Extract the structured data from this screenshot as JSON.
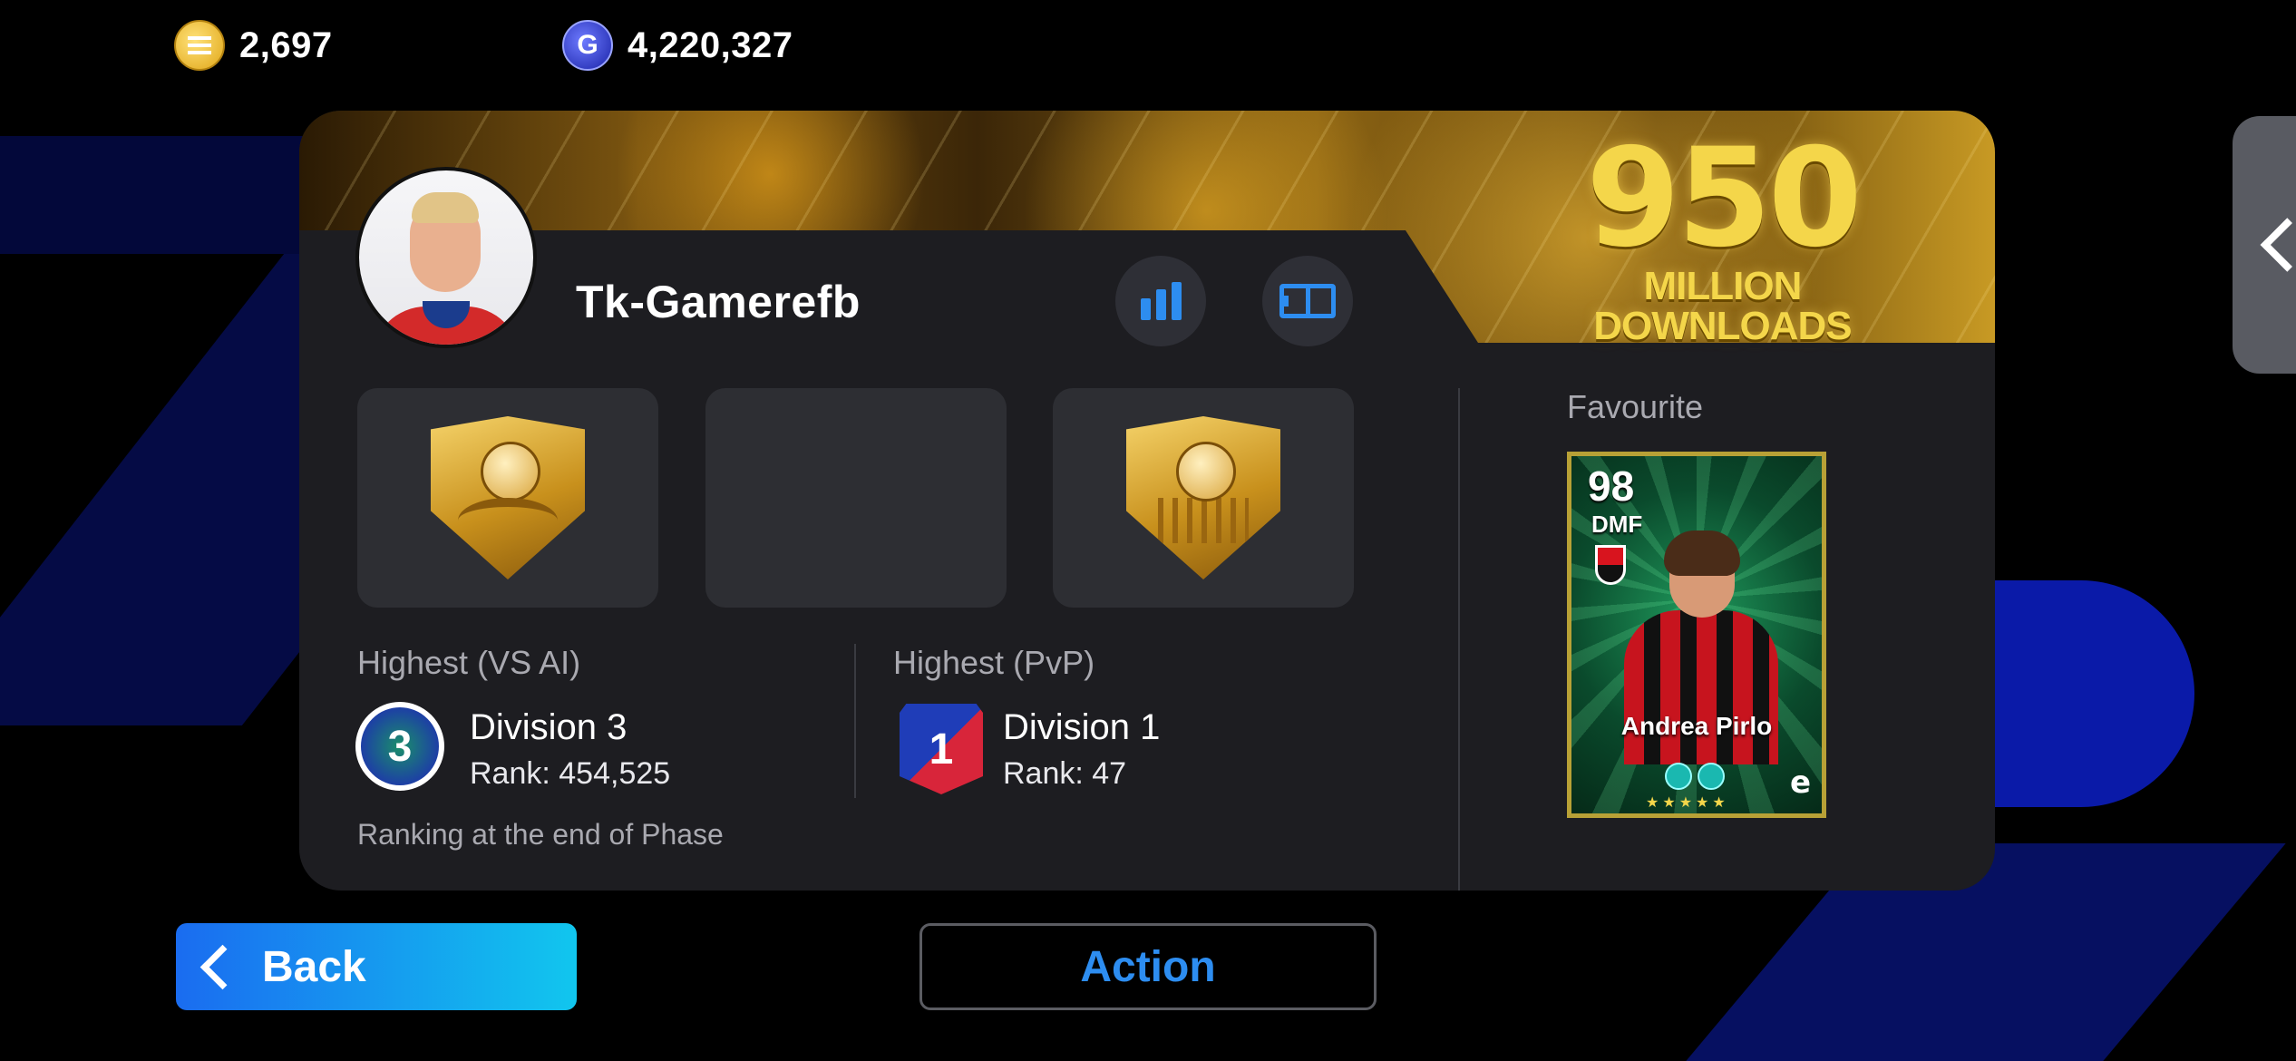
{
  "currency": {
    "coins": "2,697",
    "gp": "4,220,327"
  },
  "banner": {
    "number": "950",
    "line1": "MILLION",
    "line2": "DOWNLOADS"
  },
  "profile": {
    "username": "Tk-Gamerefb"
  },
  "stats": {
    "ai": {
      "label": "Highest (VS AI)",
      "badge": "3",
      "division": "Division 3",
      "rank": "Rank: 454,525"
    },
    "pvp": {
      "label": "Highest (PvP)",
      "badge": "1",
      "division": "Division 1",
      "rank": "Rank: 47"
    },
    "note": "Ranking at the end of Phase"
  },
  "favourite": {
    "label": "Favourite",
    "rating": "98",
    "position": "DMF",
    "name": "Andrea Pirlo",
    "stars": "★★★★★",
    "logo": "e"
  },
  "buttons": {
    "back": "Back",
    "action": "Action"
  },
  "colors": {
    "accent": "#2d8df0",
    "back_gradient_start": "#1a6cf0",
    "back_gradient_end": "#11c6ee",
    "panel": "#1d1d21"
  },
  "icons": [
    "coin-icon",
    "gp-icon",
    "stats-icon",
    "formation-icon",
    "chevron-left-icon"
  ]
}
